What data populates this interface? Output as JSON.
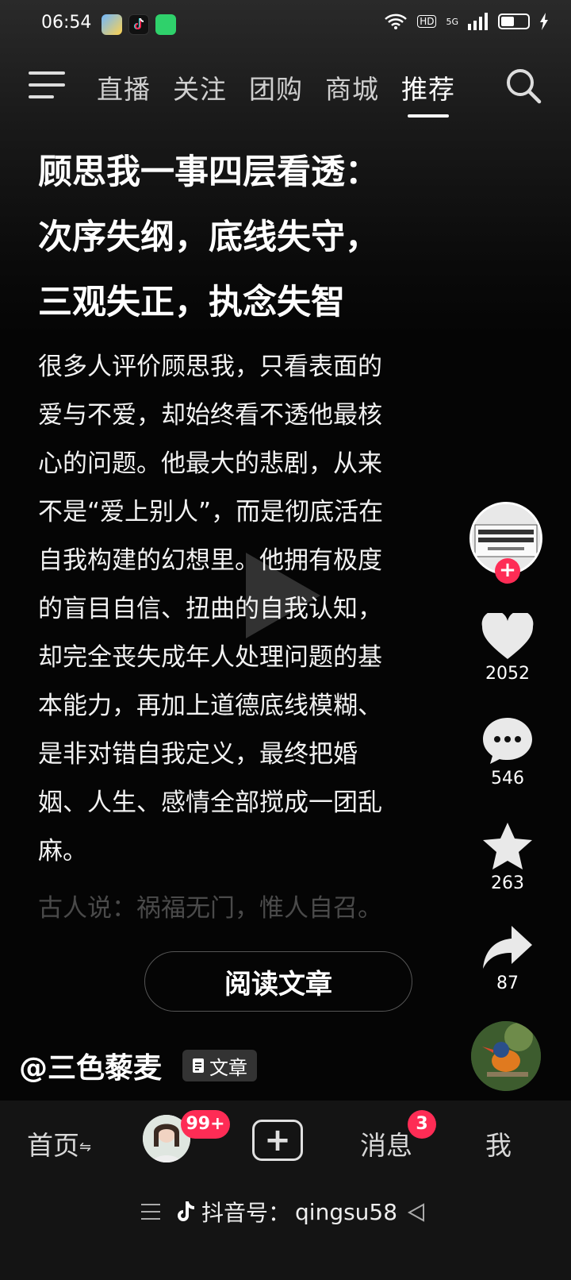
{
  "status_bar": {
    "time": "06:54",
    "hd": "HD",
    "net": "5G"
  },
  "top_nav": {
    "tabs": [
      "直播",
      "关注",
      "团购",
      "商城",
      "推荐"
    ],
    "active_index": 4
  },
  "article": {
    "title_lines": [
      "顾思我一事四层看透：",
      "次序失纲，底线失守，",
      "三观失正，执念失智"
    ],
    "body_lines": [
      "很多人评价顾思我，只看表面的",
      "爱与不爱，却始终看不透他最核",
      "心的问题。他最大的悲剧，从来",
      "不是“爱上别人”，而是彻底活在",
      "自我构建的幻想里。他拥有极度",
      "的盲目自信、扭曲的自我认知，",
      "却完全丧失成年人处理问题的基",
      "本能力，再加上道德底线模糊、",
      "是非对错自我定义，最终把婚",
      "姻、人生、感情全部搅成一团乱",
      "麻。"
    ],
    "faded_line": "古人说：祸福无门，惟人自召。",
    "read_button": "阅读文章"
  },
  "rail": {
    "likes": "2052",
    "comments": "546",
    "favorites": "263",
    "shares": "87"
  },
  "author": {
    "name": "@三色藜麦",
    "tag": "文章"
  },
  "bottom_nav": {
    "home": "首页",
    "friend_badge": "99+",
    "messages": "消息",
    "messages_badge": "3",
    "me": "我"
  },
  "watermark": {
    "label": "抖音号：",
    "id": "qingsu58"
  },
  "colors": {
    "accent": "#fe2c55",
    "background": "#050505"
  }
}
